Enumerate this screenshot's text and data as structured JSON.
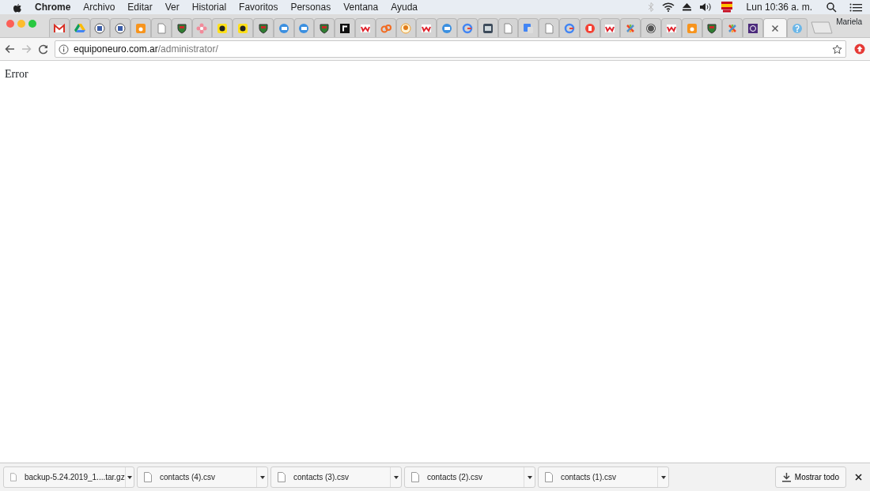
{
  "menu_bar": {
    "app": "Chrome",
    "items": [
      "Archivo",
      "Editar",
      "Ver",
      "Historial",
      "Favoritos",
      "Personas",
      "Ventana",
      "Ayuda"
    ],
    "clock": "Lun 10:36 a. m."
  },
  "tabs": [
    {
      "kind": "gmail",
      "selected": false
    },
    {
      "kind": "drive",
      "selected": false
    },
    {
      "kind": "seal",
      "selected": false
    },
    {
      "kind": "seal",
      "selected": false
    },
    {
      "kind": "orange-square",
      "selected": false
    },
    {
      "kind": "page",
      "selected": false
    },
    {
      "kind": "crest",
      "selected": false
    },
    {
      "kind": "flower",
      "selected": false
    },
    {
      "kind": "yellow-square",
      "selected": false
    },
    {
      "kind": "yellow-square",
      "selected": false
    },
    {
      "kind": "crest",
      "selected": false
    },
    {
      "kind": "blue-mail",
      "selected": false
    },
    {
      "kind": "blue-mail",
      "selected": false
    },
    {
      "kind": "crest",
      "selected": false
    },
    {
      "kind": "black-square",
      "selected": false
    },
    {
      "kind": "red-mark",
      "selected": false
    },
    {
      "kind": "orange-mark",
      "selected": false
    },
    {
      "kind": "orange-circle",
      "selected": false
    },
    {
      "kind": "red-mark",
      "selected": false
    },
    {
      "kind": "blue-mail",
      "selected": false
    },
    {
      "kind": "ring",
      "selected": false
    },
    {
      "kind": "photo",
      "selected": false
    },
    {
      "kind": "page",
      "selected": false
    },
    {
      "kind": "blue-square",
      "selected": false
    },
    {
      "kind": "page",
      "selected": false
    },
    {
      "kind": "ring",
      "selected": false
    },
    {
      "kind": "red-circle",
      "selected": false
    },
    {
      "kind": "red-mark",
      "selected": false
    },
    {
      "kind": "pinwheel",
      "selected": false
    },
    {
      "kind": "grey-circle",
      "selected": false
    },
    {
      "kind": "red-mark",
      "selected": false
    },
    {
      "kind": "orange-square",
      "selected": false
    },
    {
      "kind": "crest",
      "selected": false
    },
    {
      "kind": "pinwheel",
      "selected": false
    },
    {
      "kind": "purple-square",
      "selected": false
    },
    {
      "kind": "close",
      "selected": true
    },
    {
      "kind": "help",
      "selected": false
    }
  ],
  "profile": "Mariela",
  "address_bar": {
    "host": "equiponeuro.com.ar",
    "path": "/administrator/"
  },
  "page": {
    "text": "Error"
  },
  "downloads": [
    {
      "name": "backup-5.24.2019_1....tar.gz"
    },
    {
      "name": "contacts (4).csv"
    },
    {
      "name": "contacts (3).csv"
    },
    {
      "name": "contacts (2).csv"
    },
    {
      "name": "contacts (1).csv"
    }
  ],
  "show_all": "Mostrar todo"
}
